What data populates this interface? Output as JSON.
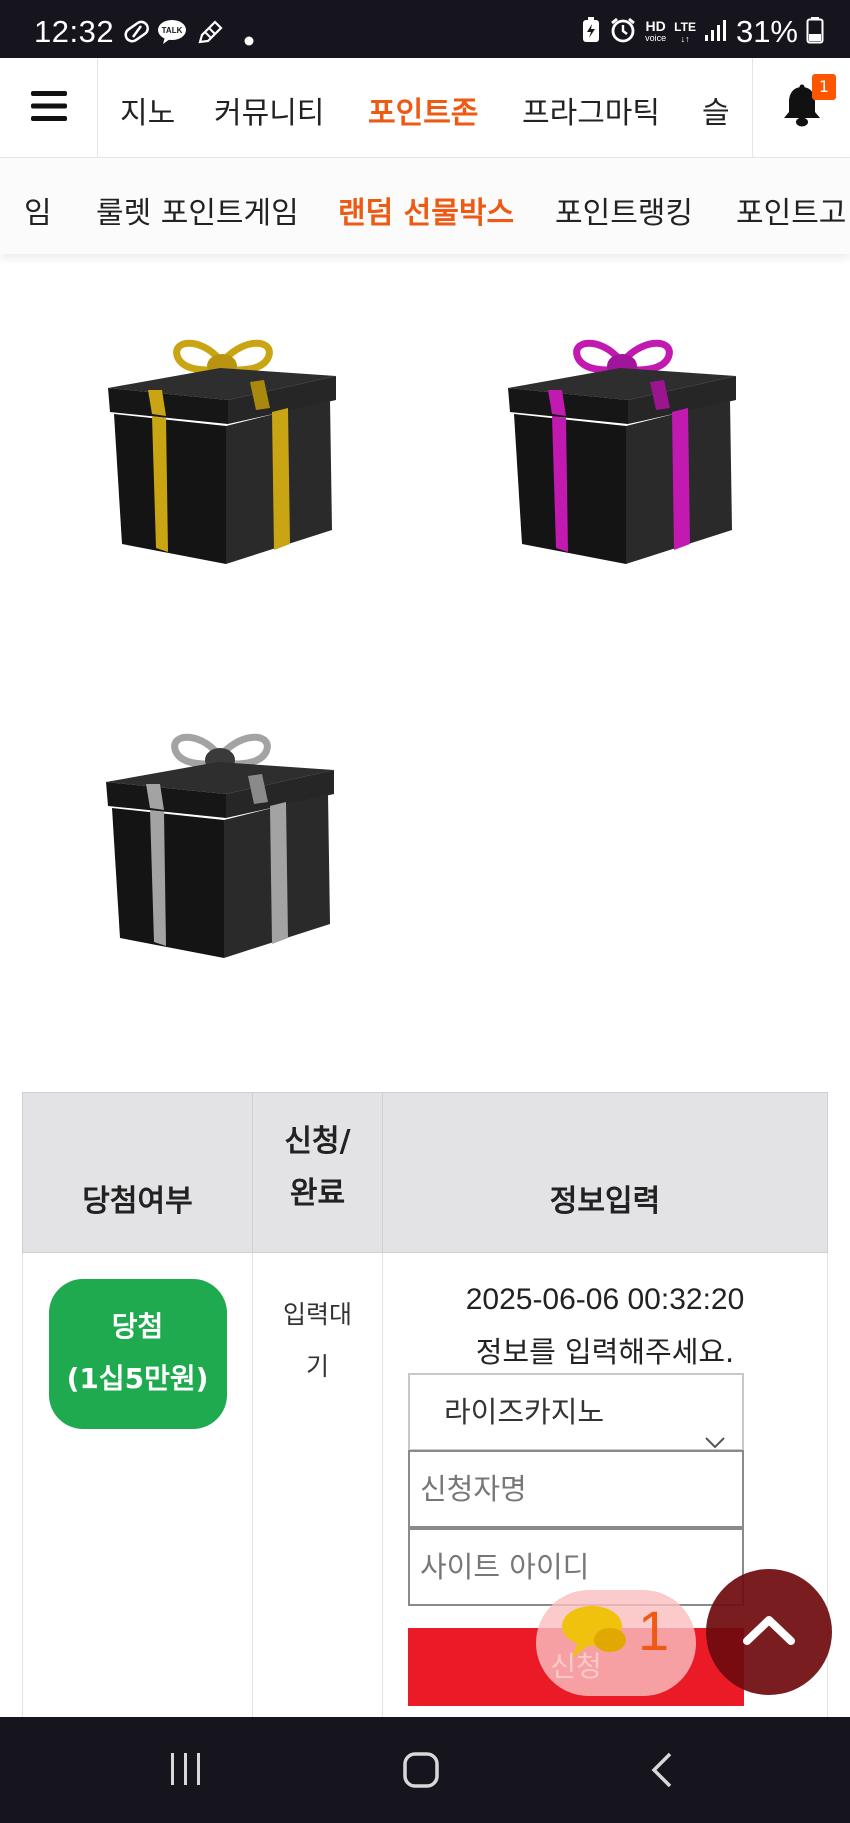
{
  "status_bar": {
    "time": "12:32",
    "network_hd": "HD",
    "network_voice": "voice",
    "network_lte": "LTE",
    "battery": "31%",
    "icons": [
      "pill-icon",
      "talk-icon",
      "pen-icon",
      "dot-icon",
      "battery-saver-icon",
      "alarm-icon",
      "signal-icon",
      "battery-icon"
    ]
  },
  "top_nav": {
    "items": [
      {
        "label": "지노"
      },
      {
        "label": "커뮤니티"
      },
      {
        "label": "포인트존",
        "active": true
      },
      {
        "label": "프라그마틱"
      },
      {
        "label": "슬"
      }
    ],
    "notification_count": "1"
  },
  "sub_nav": {
    "items": [
      {
        "label": "임"
      },
      {
        "label": "룰렛 포인트게임"
      },
      {
        "label": "랜덤 선물박스",
        "active": true
      },
      {
        "label": "포인트랭킹"
      },
      {
        "label": "포인트고"
      }
    ]
  },
  "gift_boxes": [
    {
      "ribbon_color": "#c9a514"
    },
    {
      "ribbon_color": "#c21ab0"
    },
    {
      "ribbon_color": "#a3a3a3"
    }
  ],
  "table": {
    "headers": {
      "result": "당첨여부",
      "apply_line1": "신청/",
      "apply_line2": "완료",
      "info": "정보입력"
    },
    "row": {
      "win_line1": "당첨",
      "win_line2": "(1십5만원)",
      "status_line1": "입력대",
      "status_line2": "기",
      "datetime": "2025-06-06 00:32:20",
      "message": "정보를 입력해주세요.",
      "site_select_value": "라이즈카지노",
      "name_placeholder": "신청자명",
      "id_placeholder": "사이트 아이디",
      "submit_label": "신청"
    }
  },
  "floating": {
    "chat_count": "1"
  },
  "colors": {
    "accent": "#ee5a14",
    "win_green": "#1faa50",
    "submit_red": "#ea1b27",
    "system_bar": "#16151d"
  }
}
